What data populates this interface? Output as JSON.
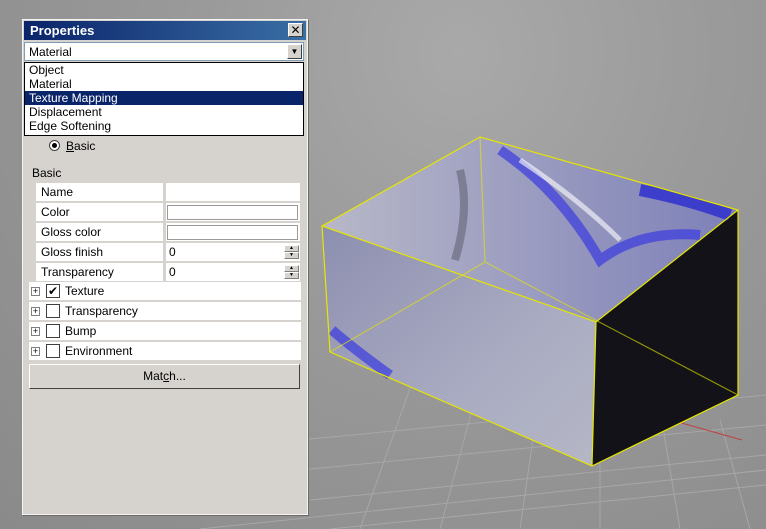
{
  "panel": {
    "title": "Properties",
    "close_glyph": "✕",
    "combo_value": "Material",
    "dropdown_options": [
      {
        "label": "Object",
        "selected": false
      },
      {
        "label": "Material",
        "selected": false
      },
      {
        "label": "Texture Mapping",
        "selected": true
      },
      {
        "label": "Displacement",
        "selected": false
      },
      {
        "label": "Edge Softening",
        "selected": false
      }
    ],
    "radio_label_first": "B",
    "radio_label_rest": "asic",
    "section_label": "Basic",
    "properties": [
      {
        "name": "Name",
        "kind": "empty",
        "value": ""
      },
      {
        "name": "Color",
        "kind": "color",
        "value": ""
      },
      {
        "name": "Gloss color",
        "kind": "color",
        "value": ""
      },
      {
        "name": "Gloss finish",
        "kind": "spin",
        "value": "0"
      },
      {
        "name": "Transparency",
        "kind": "spin",
        "value": "0"
      }
    ],
    "tree_items": [
      {
        "label": "Texture",
        "checked": true
      },
      {
        "label": "Transparency",
        "checked": false
      },
      {
        "label": "Bump",
        "checked": false
      },
      {
        "label": "Environment",
        "checked": false
      }
    ],
    "match_button_pre": "Mat",
    "match_button_accel": "c",
    "match_button_post": "h..."
  },
  "colors": {
    "panel_bg": "#d6d3ce",
    "title_bar": "#0a246a",
    "selection": "#0a246a",
    "wireframe": "#e6e600",
    "viewport_bg": "#9a9a9a"
  }
}
